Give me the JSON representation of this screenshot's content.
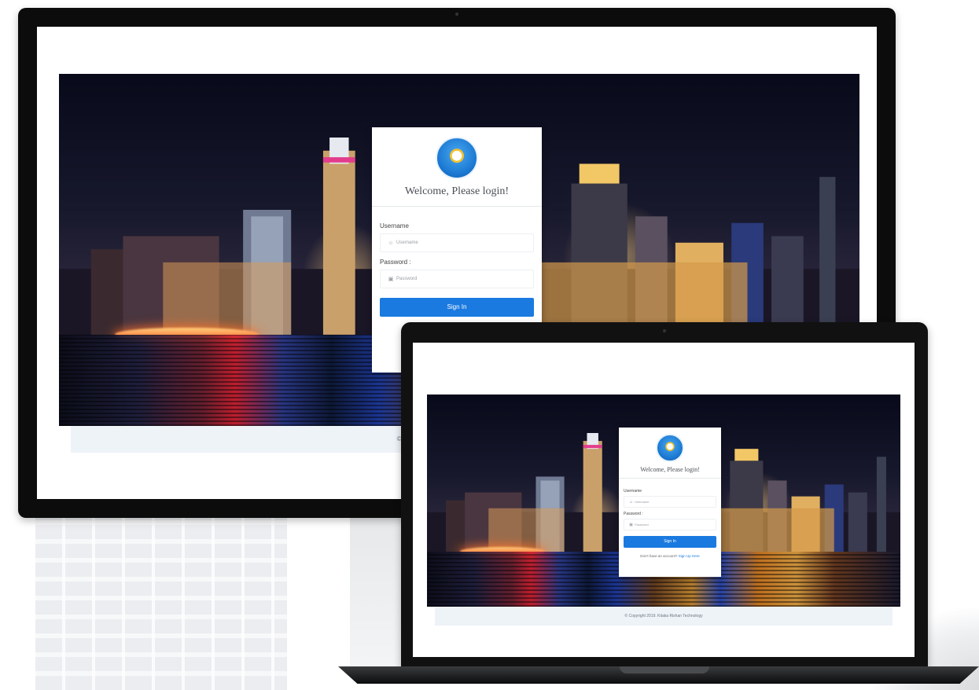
{
  "login": {
    "welcome": "Welcome, Please login!",
    "username_label": "Username",
    "username_placeholder": "Username",
    "password_label": "Password :",
    "password_placeholder": "Password",
    "signin_label": "Sign In",
    "no_account_text": "Don't have an account?",
    "signup_link": "Sign Up Here"
  },
  "footer": {
    "copyright": "© Copyright 2019. Kitaka Rishan Technology"
  },
  "icons": {
    "logo": "tut-wuri-handayani-logo",
    "username": "user-icon",
    "password": "lock-icon"
  },
  "colors": {
    "primary": "#1a7ae0",
    "footer_bg": "#eef3f8"
  }
}
